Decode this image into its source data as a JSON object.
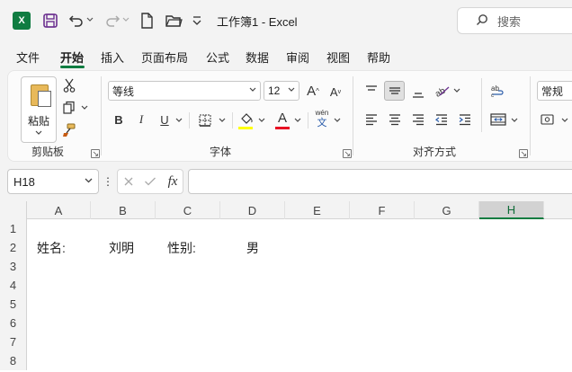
{
  "window": {
    "title": "工作簿1  -  Excel",
    "app_logo": "X",
    "search_placeholder": "搜索"
  },
  "quick_access": {
    "icons": [
      "save-icon",
      "undo-icon",
      "redo-icon",
      "new-file-icon",
      "open-folder-icon",
      "customize-icon"
    ]
  },
  "tabs": [
    "文件",
    "开始",
    "插入",
    "页面布局",
    "公式",
    "数据",
    "审阅",
    "视图",
    "帮助"
  ],
  "active_tab": "开始",
  "ribbon": {
    "clipboard": {
      "paste_label": "粘贴",
      "group_label": "剪贴板"
    },
    "font": {
      "font_name": "等线",
      "font_size": "12",
      "group_label": "字体",
      "bold": "B",
      "italic": "I",
      "underline": "U",
      "phonetic": "wén",
      "phonetic_char": "文",
      "font_color_letter": "A",
      "fill_color": "#ffff00",
      "font_color": "#e81123"
    },
    "alignment": {
      "group_label": "对齐方式"
    },
    "number": {
      "format": "常规"
    }
  },
  "formula_bar": {
    "name_box": "H18",
    "fx_label": "fx",
    "formula": ""
  },
  "grid": {
    "columns": [
      "A",
      "B",
      "C",
      "D",
      "E",
      "F",
      "G",
      "H"
    ],
    "selected_column": "H",
    "rows": [
      "1",
      "2",
      "3",
      "4",
      "5",
      "6",
      "7",
      "8"
    ],
    "cells": {
      "A2": "姓名:",
      "B2": "刘明",
      "C2": "性别:",
      "D2": "男"
    }
  },
  "colors": {
    "accent": "#107c41"
  }
}
